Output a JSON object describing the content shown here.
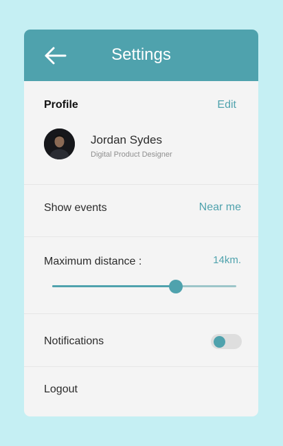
{
  "header": {
    "title": "Settings",
    "back_icon": "arrow-left-icon"
  },
  "profile": {
    "section_label": "Profile",
    "edit_label": "Edit",
    "name": "Jordan Sydes",
    "role": "Digital Product Designer"
  },
  "events": {
    "label": "Show events",
    "value": "Near me"
  },
  "distance": {
    "label": "Maximum distance :",
    "value": "14km.",
    "slider_fraction": 0.67
  },
  "notifications": {
    "label": "Notifications",
    "enabled": false
  },
  "logout": {
    "label": "Logout"
  },
  "colors": {
    "accent": "#4fa2ad",
    "background": "#c5eff3",
    "card": "#f4f4f4"
  }
}
